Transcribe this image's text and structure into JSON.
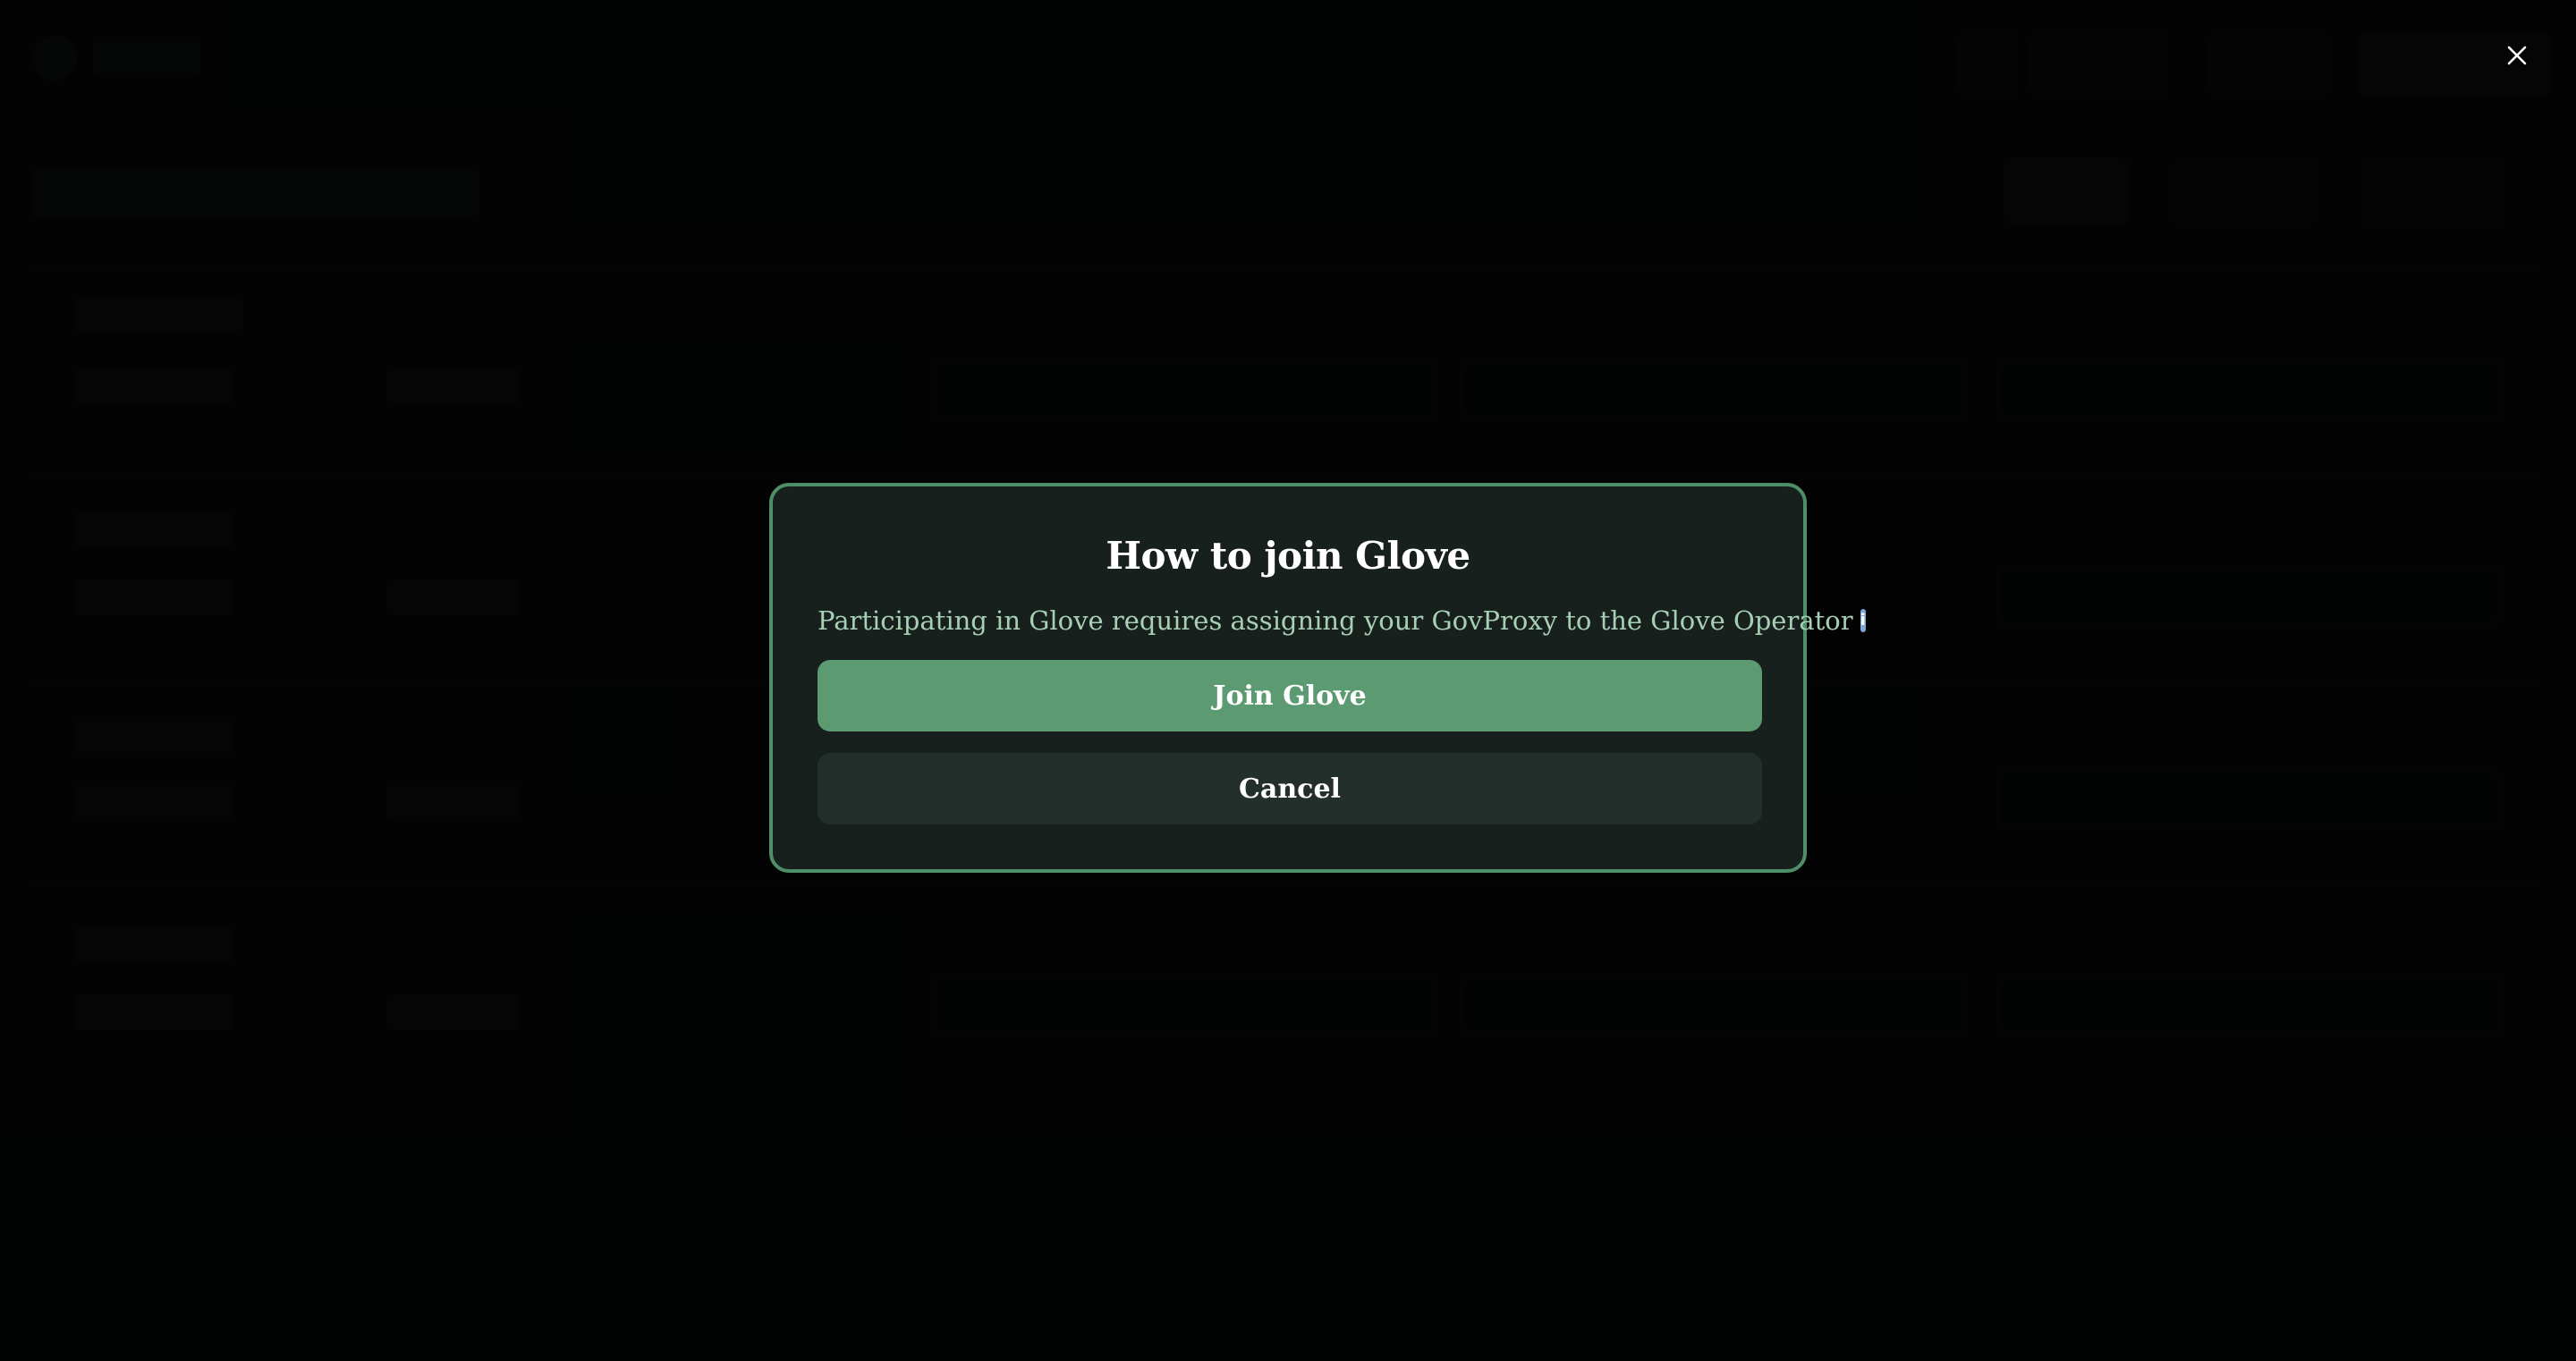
{
  "modal": {
    "title": "How to join Glove",
    "description": "Participating in Glove requires assigning your GovProxy to the Glove Operator",
    "info_icon": "info-icon",
    "join_label": "Join Glove",
    "cancel_label": "Cancel"
  },
  "overlay": {
    "close_icon": "close-icon"
  },
  "colors": {
    "accent": "#5c9a72",
    "modal_border": "#4f8f68",
    "modal_bg": "#18201e",
    "text_muted": "#a7cfb4"
  }
}
